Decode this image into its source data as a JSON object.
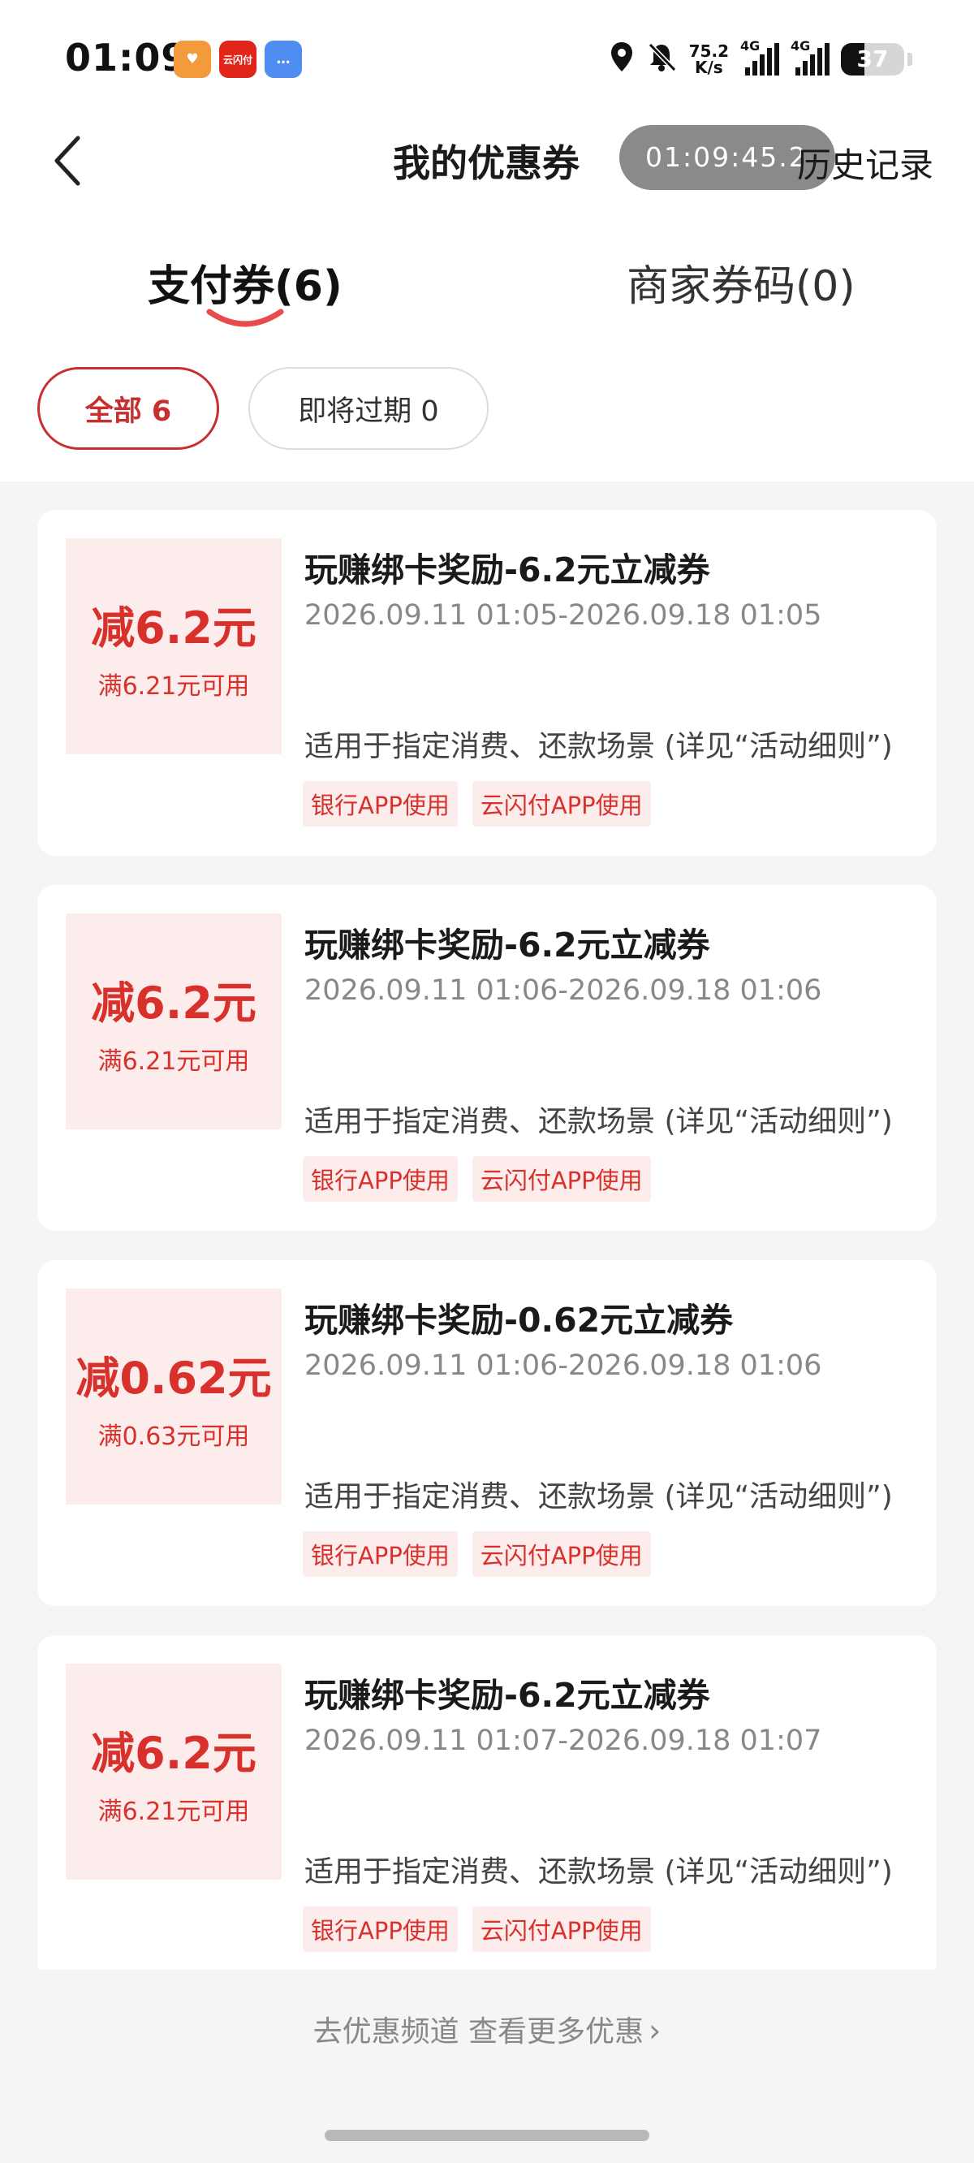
{
  "status_bar": {
    "time": "01:09",
    "apps": [
      {
        "name": "heart-app",
        "label": "♥"
      },
      {
        "name": "unionpay-app",
        "label": "云闪付"
      },
      {
        "name": "message-app",
        "label": "…"
      }
    ],
    "net_speed_value": "75.2",
    "net_speed_unit": "K/s",
    "signal1_label": "4G",
    "signal2_label": "4G",
    "battery": "37",
    "battery_level": 0.37
  },
  "header": {
    "title": "我的优惠券",
    "timer": "01:09:45.2",
    "history_label": "历史记录"
  },
  "tabs": [
    {
      "label": "支付券(6)",
      "active": true
    },
    {
      "label": "商家券码(0)",
      "active": false
    }
  ],
  "filters": [
    {
      "label": "全部 6",
      "active": true
    },
    {
      "label": "即将过期 0",
      "active": false
    }
  ],
  "coupons": [
    {
      "amount": "减6.2元",
      "condition": "满6.21元可用",
      "title": "玩赚绑卡奖励-6.2元立减券",
      "period": "2026.09.11 01:05-2026.09.18 01:05",
      "desc": "适用于指定消费、还款场景 (详见“活动细则”)",
      "tags": [
        "银行APP使用",
        "云闪付APP使用"
      ]
    },
    {
      "amount": "减6.2元",
      "condition": "满6.21元可用",
      "title": "玩赚绑卡奖励-6.2元立减券",
      "period": "2026.09.11 01:06-2026.09.18 01:06",
      "desc": "适用于指定消费、还款场景 (详见“活动细则”)",
      "tags": [
        "银行APP使用",
        "云闪付APP使用"
      ]
    },
    {
      "amount": "减0.62元",
      "condition": "满0.63元可用",
      "title": "玩赚绑卡奖励-0.62元立减券",
      "period": "2026.09.11 01:06-2026.09.18 01:06",
      "desc": "适用于指定消费、还款场景 (详见“活动细则”)",
      "tags": [
        "银行APP使用",
        "云闪付APP使用"
      ]
    },
    {
      "amount": "减6.2元",
      "condition": "满6.21元可用",
      "title": "玩赚绑卡奖励-6.2元立减券",
      "period": "2026.09.11 01:07-2026.09.18 01:07",
      "desc": "适用于指定消费、还款场景 (详见“活动细则”)",
      "tags": [
        "银行APP使用",
        "云闪付APP使用"
      ]
    }
  ],
  "footer": {
    "more_link": "去优惠频道 查看更多优惠"
  },
  "colors": {
    "accent": "#d8312c",
    "chip_border": "#c7302f",
    "coupon_bg": "#fcecec"
  }
}
